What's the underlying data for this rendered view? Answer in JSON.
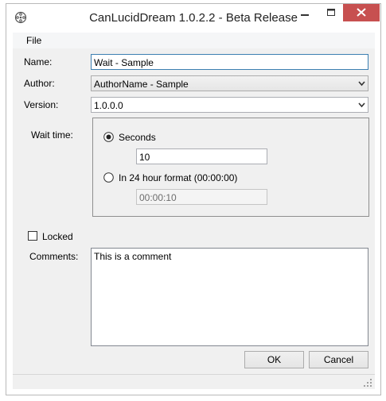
{
  "window": {
    "title": "CanLucidDream 1.0.2.2 - Beta Release",
    "icon": "film-reel-icon",
    "controls": [
      "minimize-icon",
      "maximize-icon",
      "close-icon"
    ]
  },
  "menu": {
    "file": "File"
  },
  "form": {
    "name_label": "Name:",
    "name_value": "Wait - Sample",
    "author_label": "Author:",
    "author_value": "AuthorName - Sample",
    "version_label": "Version:",
    "version_value": "1.0.0.0",
    "wait_time_label": "Wait time:",
    "seconds_label": "Seconds",
    "seconds_selected": true,
    "seconds_value": "10",
    "hour_format_label": "In 24 hour format (00:00:00)",
    "hour_format_selected": false,
    "hour_format_value": "00:00:10",
    "locked_label": "Locked",
    "locked_checked": false,
    "comments_label": "Comments:",
    "comments_value": "This is a comment"
  },
  "buttons": {
    "ok": "OK",
    "cancel": "Cancel"
  },
  "colors": {
    "close_button": "#c75050",
    "focus_border": "#3c7fb1",
    "client_bg": "#f0f0f0"
  }
}
